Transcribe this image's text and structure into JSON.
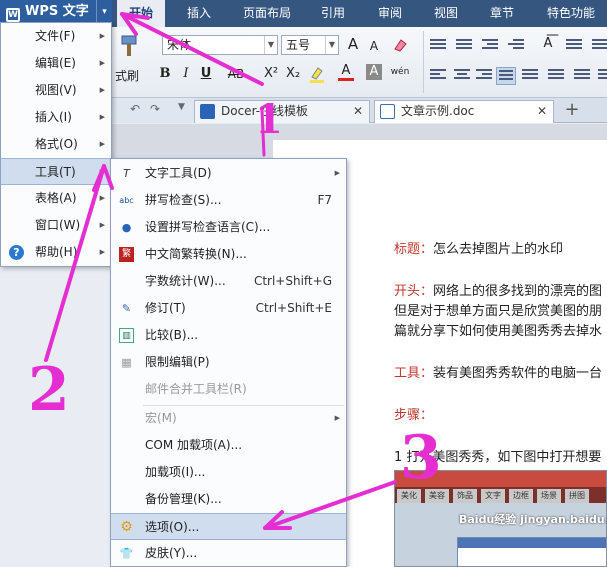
{
  "app": {
    "title": "WPS 文字"
  },
  "tabs": [
    {
      "label": "开始",
      "active": true
    },
    {
      "label": "插入"
    },
    {
      "label": "页面布局"
    },
    {
      "label": "引用"
    },
    {
      "label": "审阅"
    },
    {
      "label": "视图"
    },
    {
      "label": "章节"
    },
    {
      "label": "特色功能"
    }
  ],
  "ribbon": {
    "format_painter_label": "式刷",
    "font_name": "宋体",
    "font_size": "五号",
    "bold": "B",
    "italic": "I",
    "underline": "U",
    "strikethrough": "AB",
    "superscript": "X²",
    "subscript": "X₂",
    "font_color": "A",
    "char_shading": "A",
    "phonetic": "wén",
    "grow_font": "A",
    "shrink_font": "A"
  },
  "doc_tabs": [
    {
      "label": "Docer-在线模板"
    },
    {
      "label": "文章示例.doc"
    }
  ],
  "main_menu": [
    {
      "label": "文件(F)",
      "submenu": true
    },
    {
      "label": "编辑(E)",
      "submenu": true
    },
    {
      "label": "视图(V)",
      "submenu": true
    },
    {
      "label": "插入(I)",
      "submenu": true
    },
    {
      "label": "格式(O)",
      "submenu": true
    },
    {
      "label": "工具(T)",
      "submenu": true,
      "highlighted": true
    },
    {
      "label": "表格(A)",
      "submenu": true
    },
    {
      "label": "窗口(W)",
      "submenu": true
    },
    {
      "label": "帮助(H)",
      "submenu": true
    }
  ],
  "tools_menu": [
    {
      "label": "文字工具(D)",
      "submenu": true,
      "icon": "text-tools-icon"
    },
    {
      "label": "拼写检查(S)...",
      "shortcut": "F7",
      "icon": "spellcheck-icon"
    },
    {
      "label": "设置拼写检查语言(C)...",
      "icon": "spell-language-icon"
    },
    {
      "label": "中文简繁转换(N)...",
      "icon": "chinese-convert-icon"
    },
    {
      "label": "字数统计(W)...",
      "shortcut": "Ctrl+Shift+G"
    },
    {
      "label": "修订(T)",
      "shortcut": "Ctrl+Shift+E",
      "icon": "revision-icon"
    },
    {
      "label": "比较(B)...",
      "icon": "compare-icon"
    },
    {
      "label": "限制编辑(P)",
      "icon": "restrict-edit-icon"
    },
    {
      "label": "邮件合并工具栏(R)",
      "disabled": true
    },
    {
      "label": "宏(M)",
      "submenu": true,
      "disabled": true
    },
    {
      "label": "COM 加载项(A)..."
    },
    {
      "label": "加载项(I)..."
    },
    {
      "label": "备份管理(K)..."
    },
    {
      "label": "选项(O)...",
      "highlighted": true,
      "icon": "gear-icon"
    },
    {
      "label": "皮肤(Y)...",
      "icon": "skin-icon"
    }
  ],
  "document": {
    "title_label": "标题：",
    "title_text": "怎么去掉图片上的水印",
    "intro_label": "开头：",
    "intro_line1": "网络上的很多找到的漂亮的图",
    "intro_line2": "但是对于想单方面只是欣赏美图的朋",
    "intro_line3": "篇就分享下如何使用美图秀秀去掉水",
    "tools_label": "工具：",
    "tools_text": "装有美图秀秀软件的电脑一台",
    "steps_label": "步骤：",
    "step1": "1 打开美图秀秀，如下图中打开想要",
    "thumb_tabs": [
      "美化",
      "美容",
      "饰品",
      "文字",
      "边框",
      "场景",
      "拼图"
    ],
    "thumb_watermark": "Baidu经验 jingyan.baidu.com"
  },
  "annotations": [
    "1",
    "2",
    "3"
  ],
  "colors": {
    "accent": "#e52ed1",
    "titlebar": "#35567f",
    "menu_highlight": "#cfddef"
  }
}
